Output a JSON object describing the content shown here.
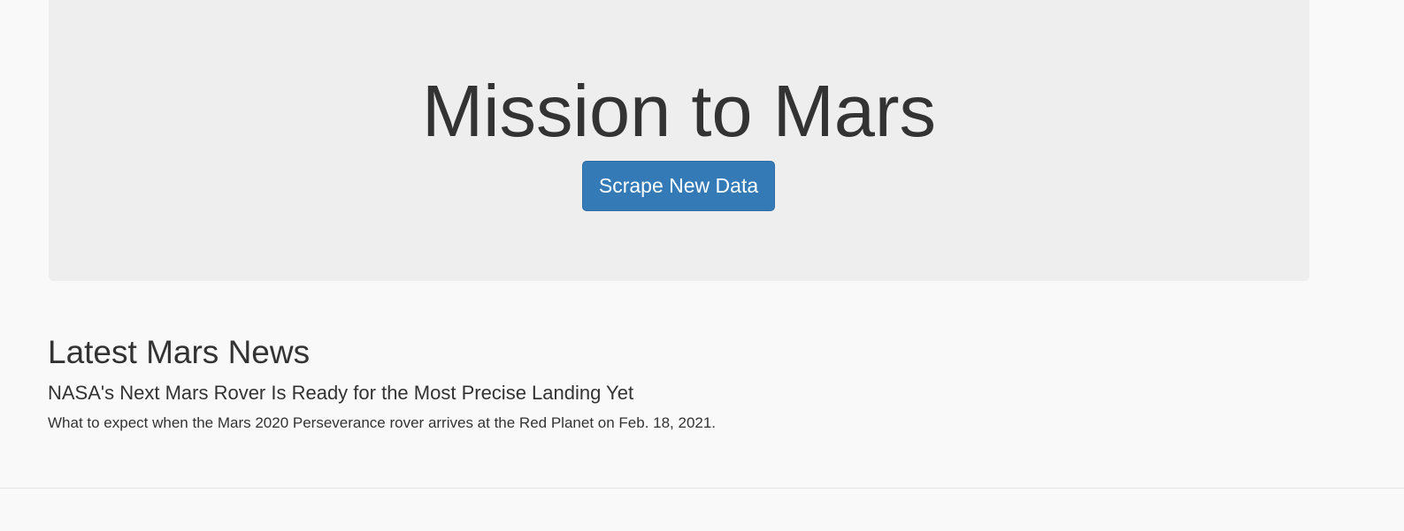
{
  "jumbotron": {
    "title": "Mission to Mars",
    "scrape_button_label": "Scrape New Data"
  },
  "news": {
    "section_heading": "Latest Mars News",
    "article_title": "NASA's Next Mars Rover Is Ready for the Most Precise Landing Yet",
    "article_teaser": "What to expect when the Mars 2020 Perseverance rover arrives at the Red Planet on Feb. 18, 2021."
  },
  "colors": {
    "page_background": "#f9f9f9",
    "jumbotron_background": "#eeeeee",
    "primary_button": "#337ab7",
    "text": "#333333"
  }
}
